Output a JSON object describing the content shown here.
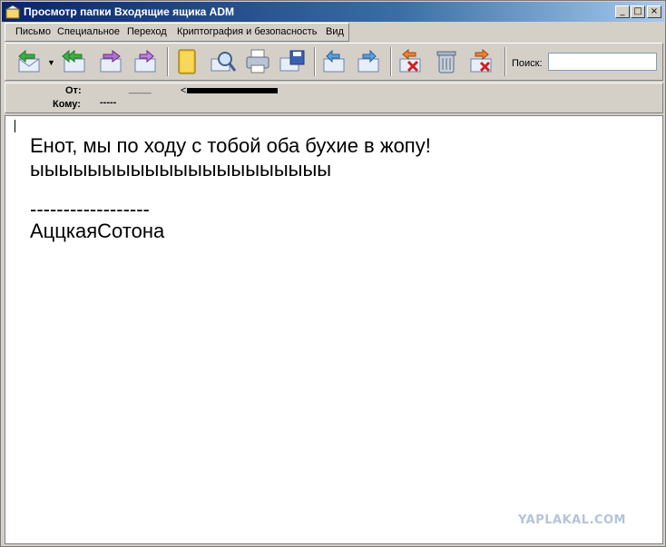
{
  "window": {
    "title": "Просмотр папки Входящие ящика ADM",
    "controls": {
      "minimize": "_",
      "maximize": "□",
      "close": "×"
    }
  },
  "menu": {
    "items": [
      "Письмо",
      "Специальное",
      "Переход",
      "Криптография и безопасность",
      "Вид"
    ]
  },
  "toolbar": {
    "search_label": "Поиск:",
    "search_value": "",
    "icons": [
      "reply-icon",
      "reply-all-icon",
      "forward-icon",
      "redirect-icon",
      "address-book-icon",
      "find-icon",
      "print-icon",
      "save-icon",
      "previous-message-icon",
      "next-message-icon",
      "delete-icon",
      "trash-icon",
      "delete-and-next-icon"
    ]
  },
  "header": {
    "from_label": "От:",
    "from_value": "____",
    "from_email_prefix": "<",
    "to_label": "Кому:",
    "to_value": "-----"
  },
  "message": {
    "line1": "Енот, мы по ходу с тобой оба бухие в жопу!",
    "line2": "ыыыыыыыыыыыыыыыыыыыыы",
    "line3": "------------------",
    "line4": "АццкаяСотона"
  },
  "watermark": "YAPLAKAL.COM",
  "colors": {
    "title_start": "#0a246a",
    "title_end": "#a6caf0",
    "chrome": "#d4d0c8"
  }
}
